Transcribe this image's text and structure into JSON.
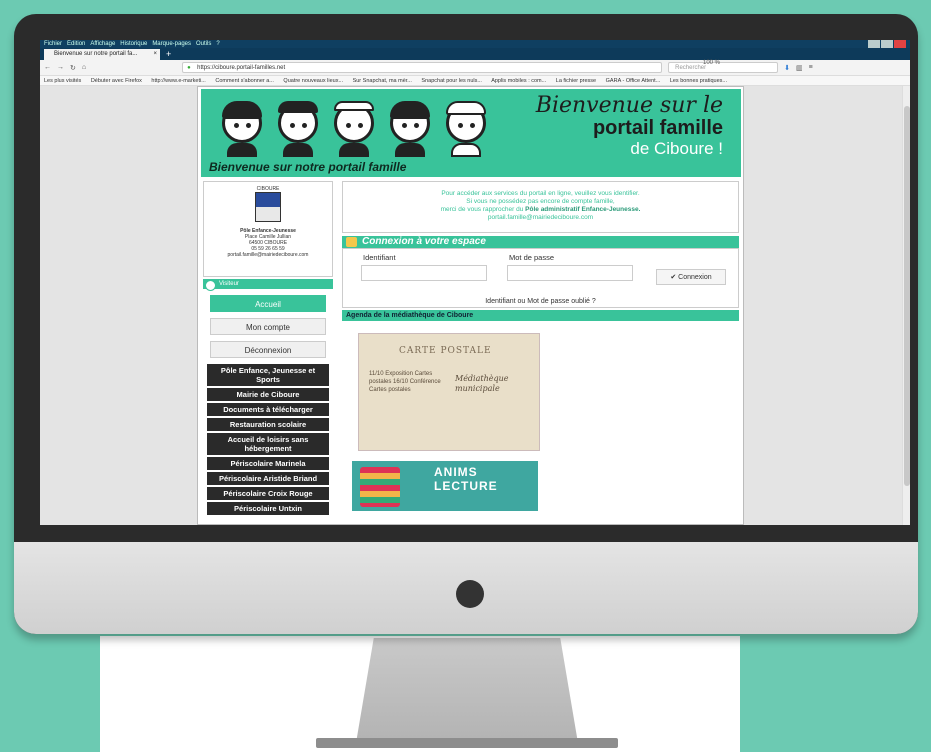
{
  "browser": {
    "menu": [
      "Fichier",
      "Édition",
      "Affichage",
      "Historique",
      "Marque-pages",
      "Outils",
      "?"
    ],
    "tab_title": "Bienvenue sur notre portail fa...",
    "new_tab_symbol": "+",
    "url": "https://ciboure.portail-familles.net",
    "zoom": "100 %",
    "search_placeholder": "Rechercher",
    "bookmarks": [
      "Les plus visités",
      "Débuter avec Firefox",
      "http://www.e-marketi...",
      "Comment s'abonner a...",
      "Quatre nouveaux lieux...",
      "Sur Snapchat, ma mèr...",
      "Snapchat pour les nuls...",
      "Applis mobiles : com...",
      "La fichier presse",
      "GARA - Office Attent...",
      "Les bonnes pratiques..."
    ]
  },
  "banner": {
    "line1": "Bienvenue sur le",
    "line2": "portail famille",
    "line3": "de Ciboure !",
    "subtitle": "Bienvenue sur notre portail famille"
  },
  "sidebar": {
    "crest_label": "CIBOURE",
    "org_name": "Pôle Enfance-Jeunesse",
    "org_address": "Place Camille Jullian",
    "org_city": "64500 CIBOURE",
    "org_phone": "05 59 26 65 59",
    "org_email": "portail.famille@mairiedeciboure.com",
    "user_label": "Visiteur",
    "btn_home": "Accueil",
    "btn_account": "Mon compte",
    "btn_logout": "Déconnexion",
    "nav": [
      "Pôle Enfance, Jeunesse et Sports",
      "Mairie de Ciboure",
      "Documents à télécharger",
      "Restauration scolaire",
      "Accueil de loisirs sans hébergement",
      "Périscolaire Marinela",
      "Périscolaire Aristide Briand",
      "Périscolaire Croix Rouge",
      "Périscolaire Untxin"
    ]
  },
  "info": {
    "line1": "Pour accéder aux services du portail en ligne, veuillez vous identifier.",
    "line2": "Si vous ne possédez pas encore de compte famille,",
    "line3_pre": "merci de vous rapprocher du",
    "line3_bold": "Pôle administratif Enfance-Jeunesse.",
    "line4": "portail.famille@mairiedeciboure.com"
  },
  "login": {
    "title": "Connexion à votre espace",
    "id_label": "Identifiant",
    "pwd_label": "Mot de passe",
    "button": "✔ Connexion",
    "forgot": "Identifiant ou Mot de passe oublié ?"
  },
  "agenda": {
    "title": "Agenda de la médiathèque de Ciboure",
    "poster_title": "CARTE POSTALE",
    "poster_left": "11/10 Exposition Cartes postales 16/10 Conférence Cartes postales",
    "poster_right": "Médiathèque municipale",
    "anims_title": "ANIMS LECTURE"
  }
}
